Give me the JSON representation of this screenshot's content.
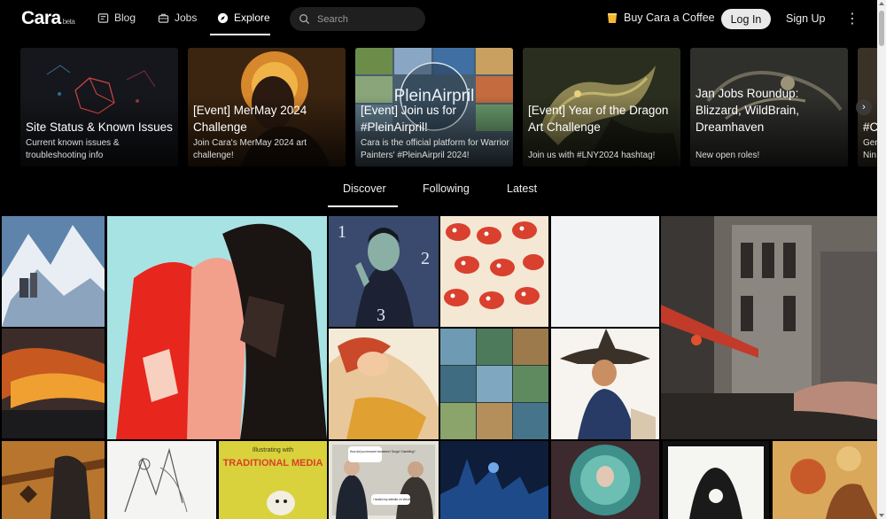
{
  "header": {
    "logo": "Cara",
    "logo_badge": "beta",
    "nav": [
      {
        "label": "Blog",
        "icon": "blog-icon"
      },
      {
        "label": "Jobs",
        "icon": "briefcase-icon"
      },
      {
        "label": "Explore",
        "icon": "compass-icon"
      }
    ],
    "active_nav": "Explore",
    "search_placeholder": "Search",
    "coffee_label": "Buy Cara a Coffee",
    "login_label": "Log In",
    "signup_label": "Sign Up"
  },
  "carousel": [
    {
      "title": "Site Status & Known Issues",
      "desc": "Current known issues & troubleshooting info"
    },
    {
      "title": "[Event] MerMay 2024 Challenge",
      "desc": "Join Cara's MerMay 2024 art challenge!"
    },
    {
      "title": "[Event] Join us for #PleinAirpril!",
      "desc": "Cara is the official platform for Warrior Painters' #PleinAirpril 2024!",
      "art_text": "PleinAirpril"
    },
    {
      "title": "[Event] Year of the Dragon Art Challenge",
      "desc": "Join us with #LNY2024 hashtag!"
    },
    {
      "title": "Jan Jobs Roundup: Blizzard, WildBrain, Dreamhaven",
      "desc": "New open roles!"
    },
    {
      "title": "#C",
      "desc": "Gen Nin"
    }
  ],
  "feed_tabs": [
    "Discover",
    "Following",
    "Latest"
  ],
  "active_tab": "Discover",
  "gallery_text": {
    "traditional_media": "TRADITIONAL MEDIA",
    "traditional_media_small": "Illustrating with",
    "comic_bubble_1": "How did you become homeless? Drugs? Gambling?",
    "comic_bubble_2": "I hosted my website on Vercel",
    "numbers": [
      "1",
      "2",
      "3"
    ]
  },
  "colors": {
    "background": "#000000",
    "search_bg": "#1f1f1f",
    "login_bg": "#e9e9e9",
    "coffee_icon": "#f5b82e"
  }
}
